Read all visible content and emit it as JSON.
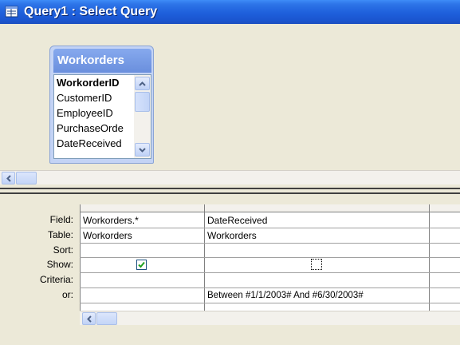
{
  "window": {
    "title": "Query1 : Select Query"
  },
  "table": {
    "name": "Workorders",
    "fields": [
      "WorkorderID",
      "CustomerID",
      "EmployeeID",
      "PurchaseOrde",
      "DateReceived"
    ]
  },
  "grid": {
    "row_labels": [
      "Field:",
      "Table:",
      "Sort:",
      "Show:",
      "Criteria:",
      "or:"
    ],
    "columns": [
      {
        "field": "Workorders.*",
        "table": "Workorders",
        "sort": "",
        "show": true,
        "criteria": "",
        "or": ""
      },
      {
        "field": "DateReceived",
        "table": "Workorders",
        "sort": "",
        "show": false,
        "criteria": "Between #1/1/2003# And #6/30/2003#",
        "or": ""
      }
    ]
  },
  "icons": {
    "title": "query-design-icon",
    "scroll_up": "scroll-up-arrow-icon",
    "scroll_down": "scroll-down-arrow-icon",
    "scroll_left": "scroll-left-arrow-icon",
    "checkmark": "checkmark-icon"
  },
  "colors": {
    "titlebar": "#1E5FDB",
    "table_header": "#7A9DE6",
    "checkmark": "#21A121"
  }
}
